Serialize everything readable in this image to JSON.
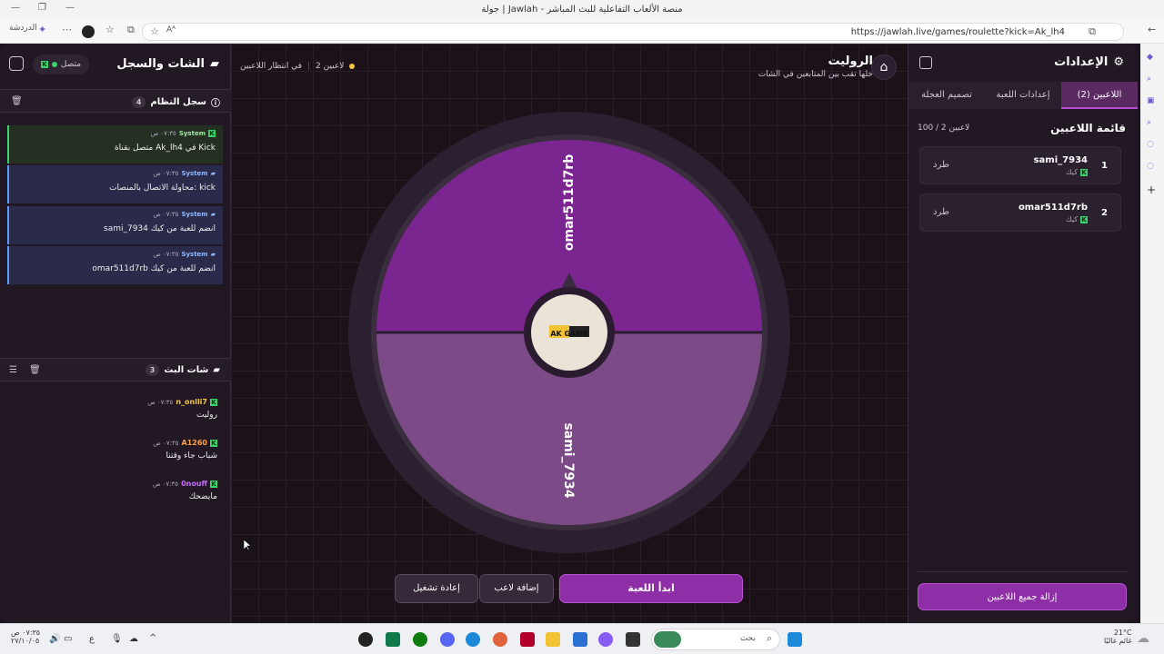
{
  "browser": {
    "window_title": "جولة | Jawlah - منصة الألعاب التفاعلية للبث المباشر",
    "url": "https://jawlah.live/games/roulette?kick=Ak_lh4",
    "chat_label": "الدردشة",
    "reader_label": "Aᴬ"
  },
  "settings": {
    "title": "الإعدادات",
    "tabs": [
      "اللاعبين (2)",
      "إعدادات اللعبة",
      "تصميم العجلة"
    ],
    "list_title": "قائمة اللاعبين",
    "count": "100 / 2 لاعبين",
    "players": [
      {
        "index": "1",
        "name": "sami_7934",
        "platform": "كيك",
        "kick": "طرد"
      },
      {
        "index": "2",
        "name": "omar511d7rb",
        "platform": "كيك",
        "kick": "طرد"
      }
    ],
    "remove_all": "إزالة جميع اللاعبين"
  },
  "chat": {
    "title": "الشات والسجل",
    "connected": "متصل",
    "system_log": {
      "title": "سجل النظام",
      "count": "4",
      "entries": [
        {
          "user": "System",
          "time": "٠٧:٣٥ ص",
          "text": "متصل بقناة Ak_lh4 في Kick"
        },
        {
          "user": "System",
          "time": "٠٧:٣٥ ص",
          "text": "محاولة الاتصال بالمنصات: kick"
        },
        {
          "user": "System",
          "time": "٠٧:٣٥ ص",
          "text": "sami_7934 انضم للعبة من كيك"
        },
        {
          "user": "System",
          "time": "٠٧:٣٥ ص",
          "text": "omar511d7rb انضم للعبة من كيك"
        }
      ]
    },
    "stream_chat": {
      "title": "شات البث",
      "count": "3",
      "messages": [
        {
          "user": "n_onlli7",
          "time": "٠٧:٣٥ ص",
          "text": "روليت",
          "color": "#f4c542"
        },
        {
          "user": "A1260",
          "time": "٠٧:٣٥ ص",
          "text": "شباب جاء وقتنا",
          "color": "#ff9f43"
        },
        {
          "user": "0nouff",
          "time": "٠٧:٣٥ ص",
          "text": "مايضحك",
          "color": "#c56bff"
        }
      ]
    }
  },
  "game": {
    "title": "الروليت",
    "subtitle": "خلها تقب بين المتابعين في الشات",
    "status_players": "2 لاعبين",
    "status_wait": "في انتظار اللاعبين",
    "wheel_top_label": "omar511d7rb",
    "wheel_bottom_label": "sami_7934",
    "logo_text": "AK GAME",
    "colors": {
      "segment_top": "#7b2590",
      "segment_bottom": "#7c4a86",
      "ring": "#2a2030"
    },
    "buttons": {
      "start": "ابدأ اللعبة",
      "add_player": "إضافة لاعب",
      "restart": "إعادة تشغيل"
    }
  },
  "taskbar": {
    "search_placeholder": "بحث",
    "time": "٠٧:٣٥ ص",
    "date": "٢٧/١٠/٠٥",
    "weather_temp": "21°C",
    "weather_desc": "غائم غالبًا",
    "lang": "ع"
  }
}
